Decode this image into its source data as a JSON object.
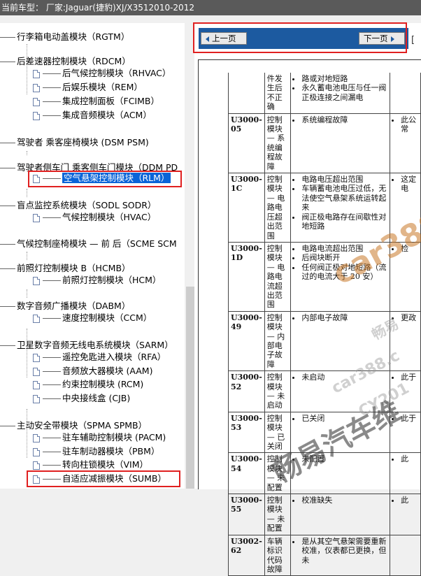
{
  "title_bar": "当前车型： 厂家:Jaguar(捷豹)XJ/X3512010-2012",
  "tree": [
    {
      "label": "行李箱电动盖模块（RGTM）",
      "level": 0
    },
    {
      "label": "后差速器控制模块（RDCM）",
      "level": 0
    },
    {
      "label": "后气候控制模块（RHVAC）",
      "level": 1
    },
    {
      "label": "后娱乐模块（REM）",
      "level": 1
    },
    {
      "label": "集成控制面板（FCIMB）",
      "level": 1
    },
    {
      "label": "集成音频模块（ACM）",
      "level": 1
    },
    {
      "label": "驾驶者 乘客座椅模块 (DSM PSM)",
      "level": 0
    },
    {
      "label": "驾驶者侧车门 乘客侧车门模块（DDM PD",
      "level": 0
    },
    {
      "label": "空气悬架控制模块（RLM）",
      "level": 1,
      "selected": true
    },
    {
      "label": "盲点监控系统模块（SODL SODR）",
      "level": 0
    },
    {
      "label": "气候控制模块（HVAC）",
      "level": 1
    },
    {
      "label": "气候控制座椅模块 — 前 后（SCME SCM",
      "level": 0
    },
    {
      "label": "前照灯控制模块 B（HCMB）",
      "level": 0
    },
    {
      "label": "前照灯控制模块（HCM）",
      "level": 1
    },
    {
      "label": "数字音频广播模块（DABM）",
      "level": 0
    },
    {
      "label": "速度控制模块（CCM）",
      "level": 1
    },
    {
      "label": "卫星数字音频无线电系统模块（SARM）",
      "level": 0
    },
    {
      "label": "遥控免匙进入模块（RFA）",
      "level": 1
    },
    {
      "label": "音频放大器模块 (AAM)",
      "level": 1
    },
    {
      "label": "约束控制模块 (RCM)",
      "level": 1
    },
    {
      "label": "中央接线盒 (CJB)",
      "level": 1
    },
    {
      "label": "主动安全带模块（SPMA SPMB）",
      "level": 0
    },
    {
      "label": "驻车辅助控制模块 (PACM)",
      "level": 1
    },
    {
      "label": "驻车制动器模块（PBM）",
      "level": 1
    },
    {
      "label": "转向柱锁模块（VIM）",
      "level": 1
    },
    {
      "label": "自适应减振模块（SUMB）",
      "level": 1
    }
  ],
  "toolbar": {
    "prev_label": "上一页",
    "next_label": "下一页"
  },
  "table_rows": [
    {
      "code": "",
      "desc": "件发生后不正确",
      "causes": [
        "路或对地短路",
        "永久蓄电池电压与任一阀正极连接之间漏电"
      ],
      "action": ""
    },
    {
      "code": "U3000-05",
      "desc": "控制模块 — 系统编程故障",
      "causes": [
        "系统编程故障"
      ],
      "action": "此公常"
    },
    {
      "code": "U3000-1C",
      "desc": "控制模块 — 电路电压超出范围",
      "causes": [
        "电路电压超出范围",
        "车辆蓄电池电压过低，无法使空气悬架系统运转起来",
        "阀正极电路存在间歇性对地短路"
      ],
      "action": "这定电"
    },
    {
      "code": "U3000-1D",
      "desc": "控制模块 — 电路电流超出范围",
      "causes": [
        "电路电流超出范围",
        "后阀块断开",
        "任何阀正极对地短路（流过的电流大于 20 安）"
      ],
      "action": "检"
    },
    {
      "code": "U3000-49",
      "desc": "控制模块 — 内部电子故障",
      "causes": [
        "内部电子故障"
      ],
      "action": "更政"
    },
    {
      "code": "U3000-52",
      "desc": "控制模块 — 未启动",
      "causes": [
        "未启动"
      ],
      "action": "此于"
    },
    {
      "code": "U3000-53",
      "desc": "控制模块 — 已关闭",
      "causes": [
        "已关闭"
      ],
      "action": "此于"
    },
    {
      "code": "U3000-54",
      "desc": "控制模块 — 未配置",
      "causes": [
        "未配置"
      ],
      "action": "此"
    },
    {
      "code": "U3000-55",
      "desc": "控制模块 — 未配置",
      "causes": [
        "校准缺失"
      ],
      "action": "此"
    },
    {
      "code": "U3002-62",
      "desc": "车辆标识代码故障",
      "causes": [
        "是从其空气悬架需要重新校准，仪表都已更换，但未"
      ],
      "action": ""
    }
  ],
  "watermark": {
    "brand": "car388",
    "cn": "畅易",
    "url": "car388.c",
    "code": "CY201",
    "big": "畅易汽车维"
  }
}
